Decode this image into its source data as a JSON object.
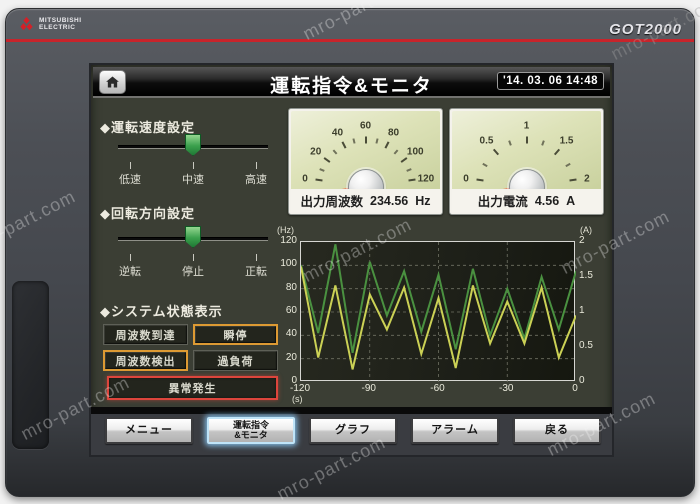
{
  "watermark": {
    "text": "mro-part.com"
  },
  "bezel": {
    "brand_line1": "MITSUBISHI",
    "brand_line2": "ELECTRIC",
    "model": "GOT2000",
    "accent_red": "#c8242b"
  },
  "titlebar": {
    "title": "運転指令&モニタ",
    "clock": "'14. 03. 06 14:48"
  },
  "left_panel": {
    "speed": {
      "heading": "◆運転速度設定",
      "ticks": [
        "低速",
        "中速",
        "高速"
      ],
      "selected": "中速"
    },
    "direction": {
      "heading": "◆回転方向設定",
      "ticks": [
        "逆転",
        "停止",
        "正転"
      ],
      "selected": "停止"
    },
    "status": {
      "heading": "◆システム状態表示",
      "indicators": [
        {
          "label": "周波数到達",
          "state": "normal"
        },
        {
          "label": "瞬停",
          "state": "warning"
        },
        {
          "label": "周波数検出",
          "state": "warning"
        },
        {
          "label": "過負荷",
          "state": "normal"
        },
        {
          "label": "異常発生",
          "state": "alarm"
        }
      ],
      "warning_color": "#dd9a33",
      "alarm_color": "#dd453c"
    }
  },
  "meters": [
    {
      "name": "出力周波数",
      "value": "234.56",
      "unit": "Hz",
      "ticks": [
        "0",
        "20",
        "40",
        "60",
        "80",
        "100",
        "120"
      ]
    },
    {
      "name": "出力電流",
      "value": "4.56",
      "unit": "A",
      "ticks": [
        "0",
        "0.5",
        "1",
        "1.5",
        "2"
      ]
    }
  ],
  "chart_data": {
    "type": "line",
    "x": [
      -120,
      -112.5,
      -105,
      -97.5,
      -90,
      -82.5,
      -75,
      -67.5,
      -60,
      -52.5,
      -45,
      -37.5,
      -30,
      -22.5,
      -15,
      -7.5,
      0
    ],
    "series": [
      {
        "name": "出力周波数",
        "axis": "left",
        "color": "#4a9140",
        "values": [
          100,
          42,
          118,
          25,
          103,
          57,
          95,
          43,
          92,
          28,
          97,
          40,
          80,
          37,
          90,
          45,
          95
        ]
      },
      {
        "name": "出力電流",
        "axis": "right",
        "color": "#cbd155",
        "values": [
          1.65,
          0.35,
          1.38,
          0.18,
          1.25,
          0.75,
          1.35,
          0.4,
          1.2,
          0.2,
          1.38,
          0.55,
          1.15,
          0.55,
          1.35,
          0.35,
          0.95
        ]
      }
    ],
    "left_axis": {
      "label": "(Hz)",
      "range": [
        0,
        120
      ],
      "ticks": [
        0,
        20,
        40,
        60,
        80,
        100,
        120
      ]
    },
    "right_axis": {
      "label": "(A)",
      "range": [
        0,
        2
      ],
      "ticks": [
        0,
        0.5,
        1,
        1.5,
        2
      ]
    },
    "x_axis": {
      "label": "(s)",
      "range": [
        -120,
        0
      ],
      "ticks": [
        -120,
        -90,
        -60,
        -30,
        0
      ]
    },
    "grid": "dashed",
    "legend": "none"
  },
  "nav": {
    "buttons": [
      {
        "line1": "メニュー",
        "active": false
      },
      {
        "line1": "運転指令",
        "line2": "&モニタ",
        "active": true
      },
      {
        "line1": "グラフ",
        "active": false
      },
      {
        "line1": "アラーム",
        "active": false
      },
      {
        "line1": "戻る",
        "active": false
      }
    ]
  }
}
